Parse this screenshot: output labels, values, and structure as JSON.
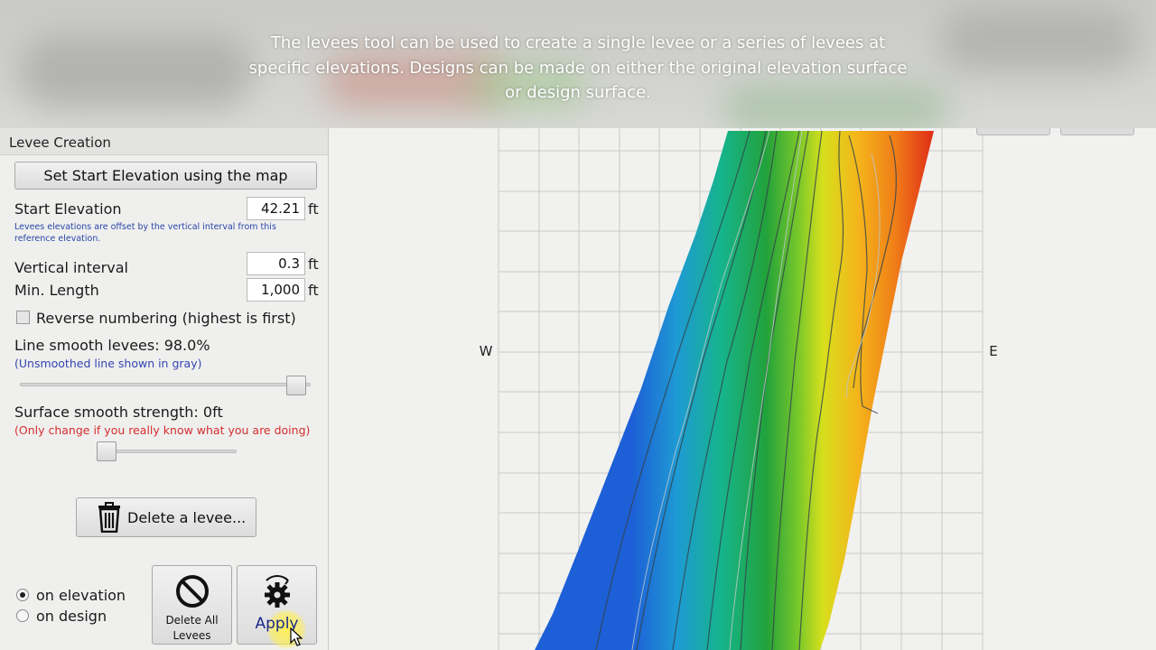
{
  "caption": {
    "text": "The levees tool can be used to create a single levee or a series of levees at specific elevations. Designs can be made on either the original elevation surface or design surface."
  },
  "panel": {
    "title": "Levee Creation",
    "set_start_button": "Set Start Elevation using the map",
    "start_elevation": {
      "label": "Start Elevation",
      "value": "42.21",
      "unit": "ft"
    },
    "start_note": "Levees elevations are offset by the vertical interval from this reference elevation.",
    "vertical_interval": {
      "label": "Vertical interval",
      "value": "0.3",
      "unit": "ft"
    },
    "min_length": {
      "label": "Min. Length",
      "value": "1,000",
      "unit": "ft"
    },
    "reverse_numbering": {
      "label": "Reverse numbering (highest is first)",
      "checked": false
    },
    "line_smooth": {
      "label": "Line smooth levees: 98.0%",
      "hint": "(Unsmoothed line shown in gray)",
      "value_percent": 98.0
    },
    "surface_smooth": {
      "label": "Surface smooth strength: 0ft",
      "hint": "(Only change if you really know what you are doing)"
    },
    "delete_levee_button": "Delete a levee...",
    "surface_options": [
      {
        "label": "on elevation",
        "selected": true
      },
      {
        "label": "on design",
        "selected": false
      }
    ],
    "delete_all_button": "Delete All Levees",
    "apply_button": "Apply"
  },
  "map": {
    "compass_west": "W",
    "compass_east": "E"
  },
  "icons": {
    "trash": "trash-icon",
    "no": "no-entry-icon",
    "gear": "gear-icon",
    "cursor": "cursor-icon"
  }
}
